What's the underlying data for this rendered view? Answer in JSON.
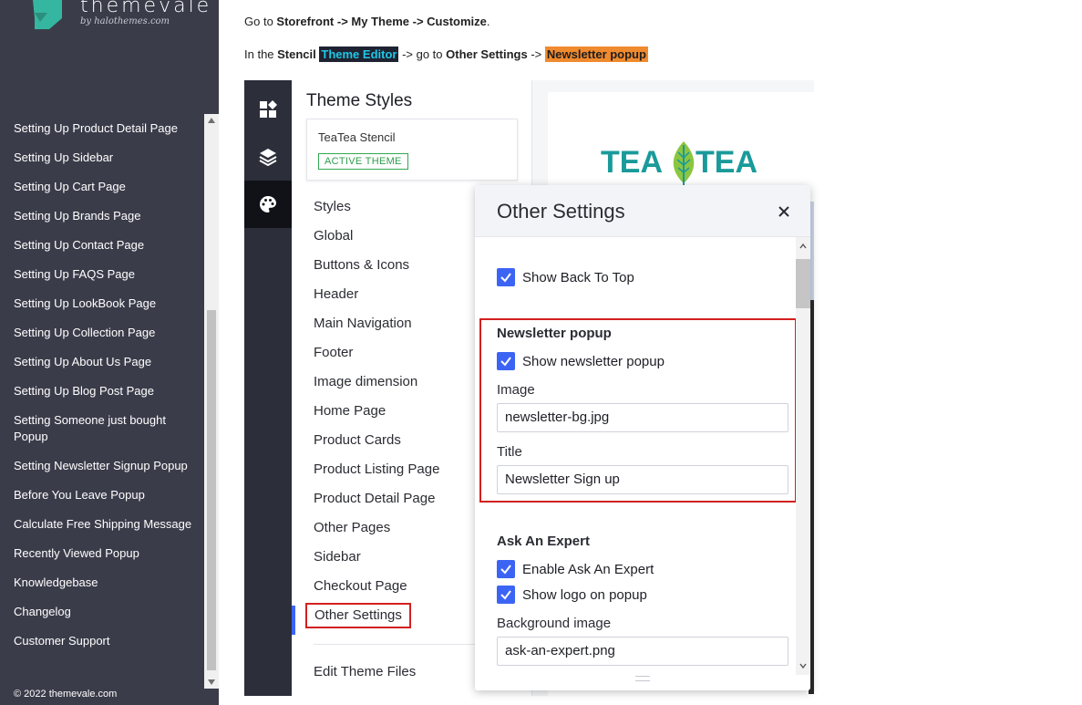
{
  "brand": {
    "name": "themevale",
    "sub": "by halothemes.com"
  },
  "docs_nav": [
    "Setting Up Product Detail Page",
    "Setting Up Sidebar",
    "Setting Up Cart Page",
    "Setting Up Brands Page",
    "Setting Up Contact Page",
    "Setting Up FAQS Page",
    "Setting Up LookBook Page",
    "Setting Up Collection Page",
    "Setting Up About Us Page",
    "Setting Up Blog Post Page",
    "Setting Someone just bought Popup",
    "Setting Newsletter Signup Popup",
    "Before You Leave Popup",
    "Calculate Free Shipping Message",
    "Recently Viewed Popup",
    "Knowledgebase",
    "Changelog",
    "Customer Support"
  ],
  "copyright": "© 2022 themevale.com",
  "instructions": {
    "line1": {
      "prefix": "Go to ",
      "a": "Storefront",
      "sep1": " -> ",
      "b": "My Theme",
      "sep2": " -> ",
      "c": "Customize",
      "suffix": "."
    },
    "line2": {
      "prefix": "In the ",
      "stencil": "Stencil",
      "editor": "Theme Editor",
      "mid": " -> go to ",
      "other": "Other Settings",
      "sep": " -> ",
      "popup": "Newsletter popup"
    }
  },
  "editor": {
    "rail_icons": [
      "widgets-icon",
      "layers-icon",
      "palette-icon"
    ],
    "panel_title": "Theme Styles",
    "theme_name": "TeaTea Stencil",
    "theme_badge": "ACTIVE THEME",
    "menu": [
      "Styles",
      "Global",
      "Buttons & Icons",
      "Header",
      "Main Navigation",
      "Footer",
      "Image dimension",
      "Home Page",
      "Product Cards",
      "Product Listing Page",
      "Product Detail Page",
      "Other Pages",
      "Sidebar",
      "Checkout Page",
      "Other Settings"
    ],
    "active_menu": "Other Settings",
    "edit_files": "Edit Theme Files",
    "preview_logo": {
      "left": "TEA",
      "right": "TEA"
    },
    "colors": {
      "accent": "#3c64f4",
      "logo_teal": "#1a9a9a",
      "logo_leaf": "#8cc63f",
      "highlight_red": "#d32020"
    }
  },
  "other_settings": {
    "title": "Other Settings",
    "show_back_to_top": {
      "label": "Show Back To Top",
      "checked": true
    },
    "newsletter": {
      "heading": "Newsletter popup",
      "show": {
        "label": "Show newsletter popup",
        "checked": true
      },
      "image_label": "Image",
      "image_value": "newsletter-bg.jpg",
      "title_label": "Title",
      "title_value": "Newsletter Sign up"
    },
    "ask_expert": {
      "heading": "Ask An Expert",
      "enable": {
        "label": "Enable Ask An Expert",
        "checked": true
      },
      "show_logo": {
        "label": "Show logo on popup",
        "checked": true
      },
      "bg_label": "Background image",
      "bg_value": "ask-an-expert.png"
    }
  }
}
